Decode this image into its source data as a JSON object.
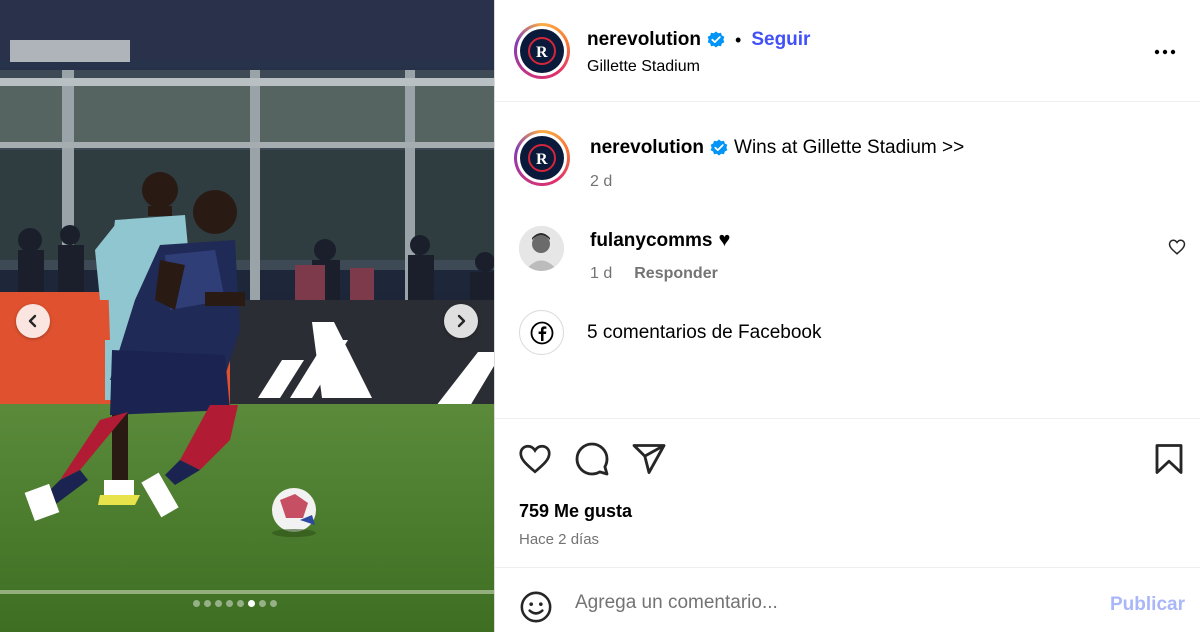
{
  "post": {
    "header": {
      "username": "nerevolution",
      "separator": "•",
      "follow_label": "Seguir",
      "location": "Gillette Stadium"
    },
    "caption": {
      "username": "nerevolution",
      "text": "Wins at Gillette Stadium >>",
      "time": "2 d"
    },
    "comment": {
      "username": "fulanycomms",
      "text": "♥",
      "time": "1 d",
      "reply_label": "Responder"
    },
    "facebook": {
      "text": "5 comentarios de Facebook"
    },
    "likes": "759 Me gusta",
    "time_ago": "Hace 2 días",
    "composer": {
      "placeholder": "Agrega un comentario...",
      "publish_label": "Publicar"
    },
    "carousel": {
      "total": 8,
      "active_index": 5
    },
    "colors": {
      "follow": "#4150f7",
      "publish_disabled": "#a9b6f8",
      "secondary_text": "#737373",
      "verified": "#0095f6"
    },
    "icons": [
      "more-icon",
      "verified-icon",
      "like-icon",
      "comment-icon",
      "share-icon",
      "save-icon",
      "emoji-icon",
      "facebook-icon",
      "chevron-left-icon",
      "chevron-right-icon"
    ]
  }
}
